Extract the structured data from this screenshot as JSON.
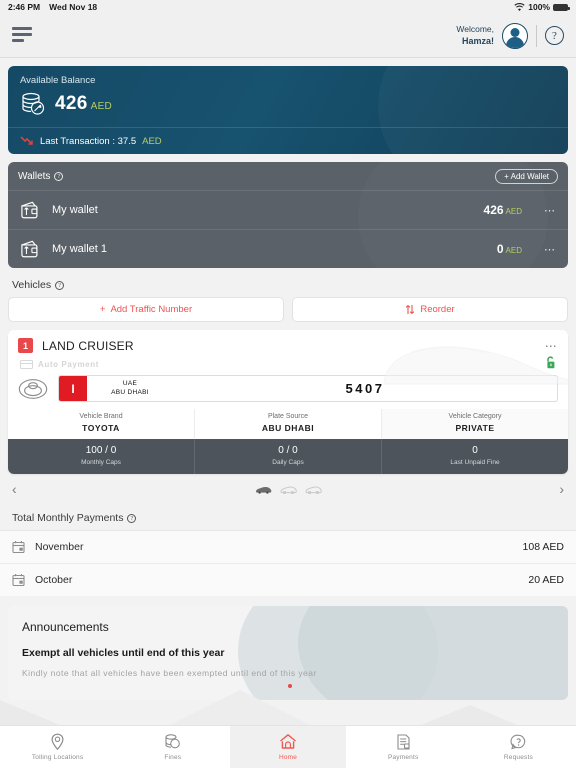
{
  "status_bar": {
    "time": "2:46 PM",
    "date": "Wed Nov 18",
    "wifi_icon": "wifi-icon",
    "battery_percent": "100%"
  },
  "header": {
    "menu_icon": "hamburger-menu-icon",
    "welcome_line1": "Welcome,",
    "welcome_line2": "Hamza!",
    "avatar_icon": "user-avatar-icon",
    "help_label": "?",
    "help_icon": "help-circle-icon"
  },
  "balance": {
    "label": "Available Balance",
    "icon": "coins-stack-icon",
    "amount": "426",
    "currency": "AED",
    "last_transaction_icon": "arrow-down-trend-icon",
    "last_transaction_label": "Last Transaction : 37.5",
    "last_transaction_currency": "AED",
    "bg_color": "#154a66",
    "currency_color": "#b7cf62"
  },
  "wallets": {
    "title": "Wallets",
    "info_icon": "info-circle-icon",
    "add_label": "+ Add Wallet",
    "bg_color": "#5b6168",
    "items": [
      {
        "icon": "wallet-icon",
        "name": "My wallet",
        "amount": "426",
        "currency": "AED",
        "menu_icon": "more-options-icon"
      },
      {
        "icon": "wallet-icon",
        "name": "My wallet 1",
        "amount": "0",
        "currency": "AED",
        "menu_icon": "more-options-icon"
      }
    ]
  },
  "vehicles": {
    "title": "Vehicles",
    "info_icon": "info-circle-icon",
    "add_traffic_number_label": "Add Traffic Number",
    "add_icon": "plus-icon",
    "reorder_label": "Reorder",
    "reorder_icon": "sort-arrows-icon",
    "accent_color": "#ef5350",
    "card": {
      "badge": "1",
      "name": "LAND CRUISER",
      "menu_icon": "more-options-icon",
      "auto_payment_label": "Auto Payment",
      "auto_payment_icon": "credit-card-icon",
      "lock_icon": "unlocked-padlock-icon",
      "lock_color": "#3aa856",
      "brand_logo_icon": "toyota-logo-icon",
      "plate": {
        "code": "I",
        "country": "UAE",
        "emirate": "ABU DHABI",
        "number": "5407",
        "code_bg": "#e01b24"
      },
      "details": [
        {
          "label": "Vehicle Brand",
          "value": "TOYOTA"
        },
        {
          "label": "Plate Source",
          "value": "ABU DHABI"
        },
        {
          "label": "Vehicle Category",
          "value": "PRIVATE"
        }
      ],
      "caps": [
        {
          "value": "100 / 0",
          "label": "Monthly Caps"
        },
        {
          "value": "0 / 0",
          "label": "Daily Caps"
        },
        {
          "value": "0",
          "label": "Last Unpaid Fine"
        }
      ]
    },
    "carousel": {
      "prev_icon": "chevron-left-icon",
      "next_icon": "chevron-right-icon",
      "dot_icon": "car-dot-icon",
      "total": 3,
      "active_index": 0
    }
  },
  "monthly_payments": {
    "title": "Total Monthly Payments",
    "info_icon": "info-circle-icon",
    "rows": [
      {
        "icon": "calendar-payment-icon",
        "month": "November",
        "amount": "108 AED"
      },
      {
        "icon": "calendar-payment-icon",
        "month": "October",
        "amount": "20 AED"
      }
    ]
  },
  "announcements": {
    "title": "Announcements",
    "headline": "Exempt all vehicles until end of this year",
    "body": "Kindly note that all vehicles have been exempted until end of this year",
    "dot_icon": "carousel-dot-icon",
    "dot_color": "#e8484a"
  },
  "bottom_nav": {
    "active_color": "#ee5a52",
    "items": [
      {
        "icon": "map-pin-icon",
        "label": "Tolling Locations",
        "active": false
      },
      {
        "icon": "fines-icon",
        "label": "Fines",
        "active": false
      },
      {
        "icon": "home-icon",
        "label": "Home",
        "active": true
      },
      {
        "icon": "document-icon",
        "label": "Payments",
        "active": false
      },
      {
        "icon": "request-icon",
        "label": "Requests",
        "active": false
      }
    ]
  }
}
